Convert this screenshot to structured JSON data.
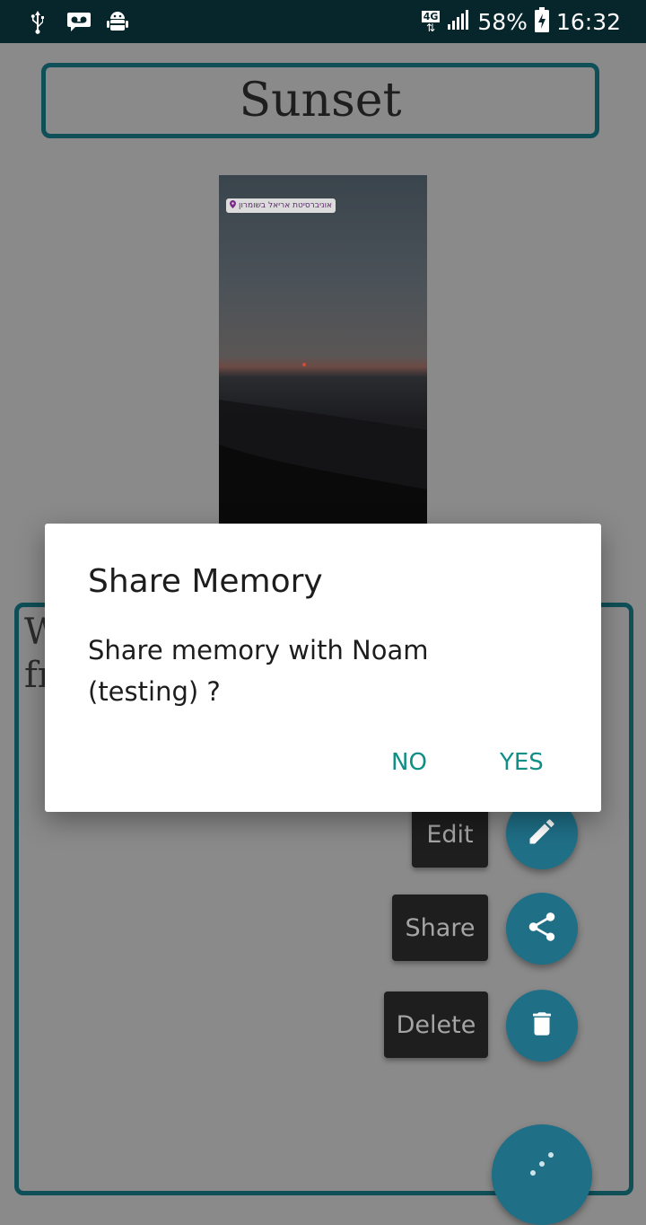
{
  "status_bar": {
    "battery": "58%",
    "time": "16:32",
    "network": "4G",
    "icons": [
      "usb-icon",
      "voicemail-icon",
      "android-debug-icon",
      "network-4g-icon",
      "signal-icon",
      "battery-charging-icon"
    ]
  },
  "memory": {
    "title": "Sunset",
    "photo_tag": "אוניברסיטת אריאל בשומרון",
    "description_fragment": "W\nfr"
  },
  "fab_menu": {
    "edit_label": "Edit",
    "share_label": "Share",
    "delete_label": "Delete",
    "icons": [
      "edit-icon",
      "share-icon",
      "delete-icon",
      "dots-icon"
    ]
  },
  "dialog": {
    "title": "Share Memory",
    "message": "Share memory with Noam (testing) ?",
    "no_label": "NO",
    "yes_label": "YES"
  },
  "colors": {
    "accent": "#0f8f86",
    "fab": "#1f6f87",
    "border": "#0f4f58",
    "status_bar": "#06262c"
  }
}
